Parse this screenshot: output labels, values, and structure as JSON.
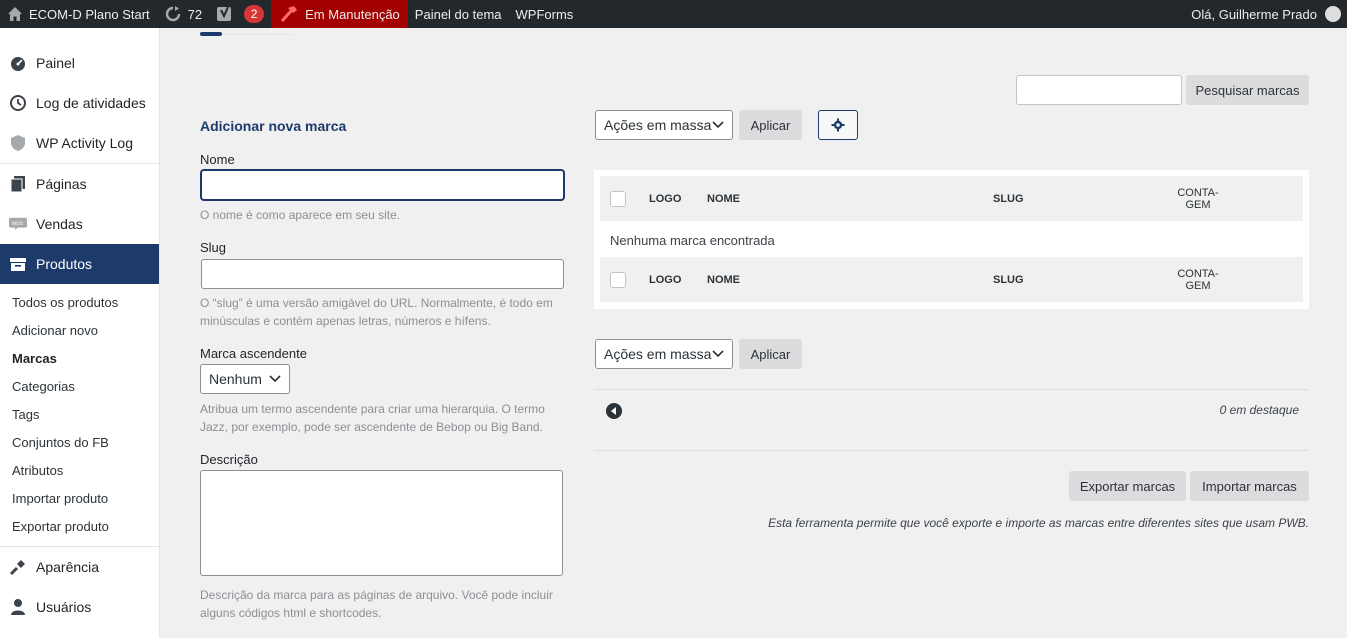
{
  "adminbar": {
    "site_name": "ECOM-D Plano Start",
    "updates_count": "72",
    "yoast_count": "2",
    "maintenance": "Em Manutenção",
    "theme_panel": "Painel do tema",
    "wpforms": "WPForms",
    "greeting": "Olá, Guilherme Prado"
  },
  "sidebar": {
    "items": [
      {
        "label": "Painel",
        "icon": "dashboard-icon"
      },
      {
        "label": "Log de atividades",
        "icon": "history-icon"
      },
      {
        "label": "WP Activity Log",
        "icon": "shield-icon"
      },
      {
        "label": "Páginas",
        "icon": "pages-icon"
      },
      {
        "label": "Vendas",
        "icon": "woo-icon"
      },
      {
        "label": "Produtos",
        "icon": "archive-icon"
      },
      {
        "label": "Aparência",
        "icon": "brush-icon"
      },
      {
        "label": "Usuários",
        "icon": "user-icon"
      }
    ],
    "submenu": [
      "Todos os produtos",
      "Adicionar novo",
      "Marcas",
      "Categorias",
      "Tags",
      "Conjuntos do FB",
      "Atributos",
      "Importar produto",
      "Exportar produto"
    ]
  },
  "form": {
    "title": "Adicionar nova marca",
    "name_label": "Nome",
    "name_help": "O nome é como aparece em seu site.",
    "slug_label": "Slug",
    "slug_help_1": "O “slug” é uma versão amigável do URL. Normalmente, é todo em",
    "slug_help_2": "minúsculas e contém apenas letras, números e hífens.",
    "parent_label": "Marca ascendente",
    "parent_value": "Nenhum",
    "parent_help_1": "Atribua um termo ascendente para criar uma hierarquia. O termo",
    "parent_help_2": "Jazz, por exemplo, pode ser ascendente de Bebop ou Big Band.",
    "desc_label": "Descrição",
    "desc_help_1": "Descrição da marca para as páginas de arquivo. Você pode incluir",
    "desc_help_2": "alguns códigos html e shortcodes."
  },
  "list": {
    "search_button": "Pesquisar marcas",
    "bulk_actions": "Ações em massa",
    "apply": "Aplicar",
    "columns": {
      "logo": "LOGO",
      "name": "NOME",
      "slug": "SLUG",
      "count_1": "CONTA-",
      "count_2": "GEM"
    },
    "empty": "Nenhuma marca encontrada",
    "featured": "0 em destaque",
    "export": "Exportar marcas",
    "import": "Importar marcas",
    "note": "Esta ferramenta permite que você exporte e importe as marcas entre diferentes sites que usam PWB."
  }
}
